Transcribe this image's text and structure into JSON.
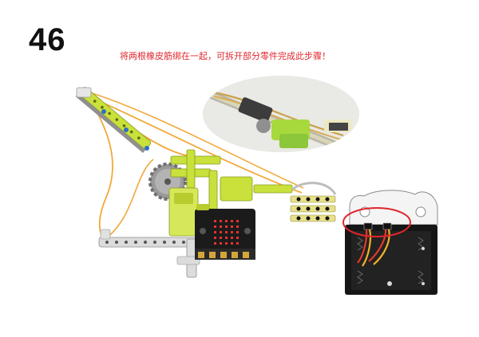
{
  "step": {
    "number": "46"
  },
  "instruction": {
    "text": "将两根橡皮筋绑在一起，可拆开部分零件完成此步骤！"
  },
  "colors": {
    "accent_red": "#e0262c",
    "rubber_band": "#f2a93b",
    "lime": "#c9e13a",
    "board_black": "#1b1b1b",
    "led_red": "#e8322e",
    "gold_pad": "#d4a63a",
    "beam_grey": "#d9d9d9"
  },
  "icons": [
    "robot-arm-model",
    "rubber-band-closeup-photo",
    "battery-box-wiring",
    "highlight-circle"
  ]
}
